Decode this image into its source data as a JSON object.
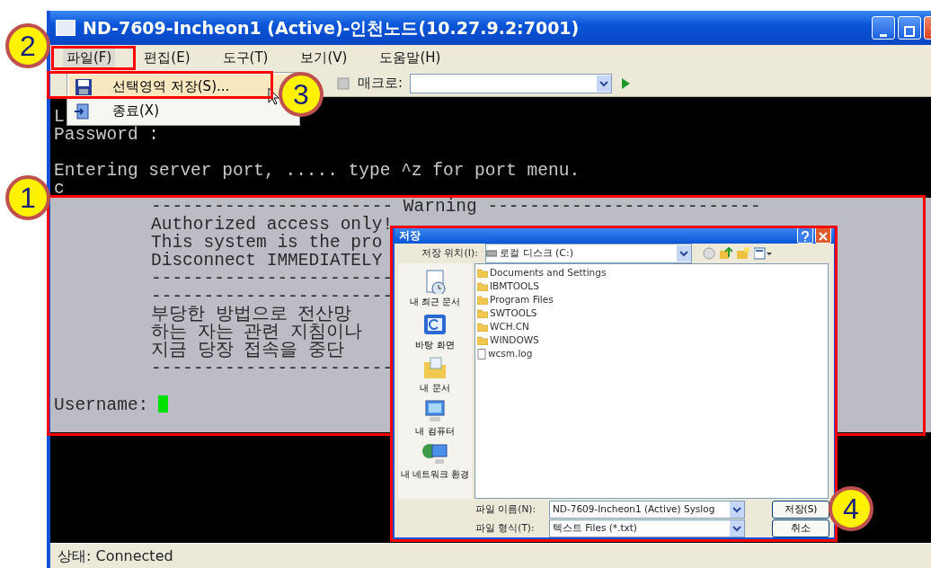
{
  "window": {
    "title": "ND-7609-Incheon1 (Active)-인천노드(10.27.9.2:7001)"
  },
  "menu": [
    {
      "label": "파일(F)",
      "selected": true
    },
    {
      "label": "편집(E)",
      "selected": false
    },
    {
      "label": "도구(T)",
      "selected": false
    },
    {
      "label": "보기(V)",
      "selected": false
    },
    {
      "label": "도움말(H)",
      "selected": false
    }
  ],
  "file_menu": [
    {
      "label": "선택영역 저장(S)...",
      "kind": "save",
      "selected": true
    },
    {
      "label": "종료(X)",
      "kind": "exit",
      "selected": false
    }
  ],
  "toolbar": {
    "macro_label": "매크로:"
  },
  "terminal": [
    {
      "text": "L",
      "kind": "plain",
      "selected": false,
      "gap_before": false
    },
    {
      "text": "Password :",
      "kind": "plain",
      "selected": false,
      "gap_before": false
    },
    {
      "text": "Entering server port, ..... type ^z for port menu.",
      "kind": "plain",
      "selected": false,
      "gap_before": true
    },
    {
      "text": "c",
      "kind": "plain",
      "selected": false,
      "gap_before": false
    },
    {
      "text": "----------------------- Warning --------------------------",
      "kind": "banner",
      "selected": true,
      "gap_before": false
    },
    {
      "text": "Authorized access only!",
      "kind": "banner",
      "selected": true,
      "gap_before": false
    },
    {
      "text": "This system is the pro",
      "kind": "banner",
      "selected": true,
      "gap_before": false
    },
    {
      "text": "Disconnect IMMEDIATELY",
      "kind": "banner",
      "selected": true,
      "gap_before": false
    },
    {
      "text": "-----------------------",
      "kind": "banner",
      "selected": true,
      "gap_before": false
    },
    {
      "text": "-----------------------",
      "kind": "banner",
      "selected": true,
      "gap_before": false
    },
    {
      "text": "부당한 방법으로 전산망",
      "kind": "banner",
      "selected": true,
      "gap_before": false
    },
    {
      "text": "하는 자는 관련 지침이나",
      "kind": "banner",
      "selected": true,
      "gap_before": false
    },
    {
      "text": "지금 당장 접속을 중단",
      "kind": "banner",
      "selected": true,
      "gap_before": false
    },
    {
      "text": "-----------------------",
      "kind": "banner",
      "selected": true,
      "gap_before": false
    },
    {
      "text": "Username:",
      "kind": "prompt",
      "selected": true,
      "gap_before": true
    }
  ],
  "status_bar": "상태: Connected",
  "dialog": {
    "title": "저장",
    "location_label": "저장 위치(I):",
    "location_value": "로컬 디스크 (C:)",
    "places": [
      {
        "label": "내 최근 문서",
        "kind": "recent"
      },
      {
        "label": "바탕 화면",
        "kind": "desktop"
      },
      {
        "label": "내 문서",
        "kind": "documents"
      },
      {
        "label": "내 컴퓨터",
        "kind": "computer"
      },
      {
        "label": "내 네트워크 환경",
        "kind": "network"
      }
    ],
    "files": [
      {
        "name": "Documents and Settings",
        "kind": "folder"
      },
      {
        "name": "IBMTOOLS",
        "kind": "folder"
      },
      {
        "name": "Program Files",
        "kind": "folder"
      },
      {
        "name": "SWTOOLS",
        "kind": "folder"
      },
      {
        "name": "WCH.CN",
        "kind": "folder"
      },
      {
        "name": "WINDOWS",
        "kind": "folder"
      },
      {
        "name": "wcsm.log",
        "kind": "file"
      }
    ],
    "filename_label": "파일 이름(N):",
    "filename_value": "ND-7609-Incheon1 (Active) Syslog",
    "filetype_label": "파일 형식(T):",
    "filetype_value": "텍스트 Files (*.txt)",
    "buttons": [
      "저장(S)",
      "취소"
    ]
  },
  "callouts": [
    {
      "number": "1"
    },
    {
      "number": "2"
    },
    {
      "number": "3"
    },
    {
      "number": "4"
    }
  ]
}
